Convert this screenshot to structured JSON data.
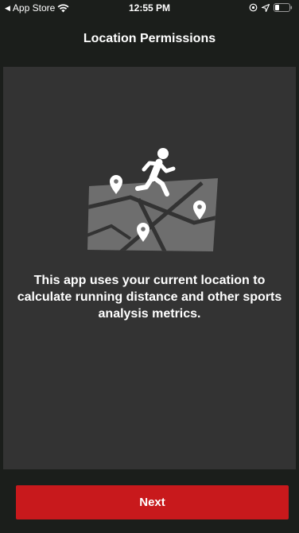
{
  "status_bar": {
    "back_label": "App Store",
    "time": "12:55 PM"
  },
  "nav": {
    "title": "Location Permissions"
  },
  "main": {
    "message": "This app uses your current location to calculate running distance and other sports analysis metrics.",
    "illustration_icon": "runner-on-map-icon"
  },
  "footer": {
    "next_label": "Next"
  },
  "colors": {
    "background": "#1b1e1b",
    "panel": "#333333",
    "accent": "#c8191c",
    "illustration": "#6e6e6e"
  }
}
